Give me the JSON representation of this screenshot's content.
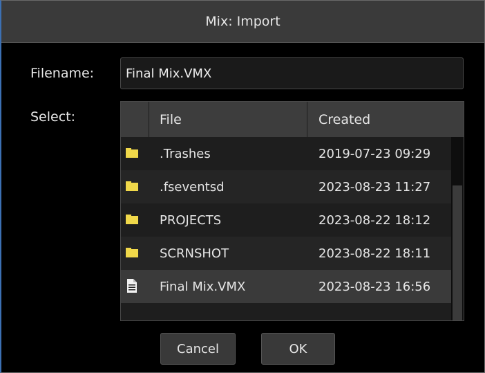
{
  "dialog": {
    "title": "Mix: Import"
  },
  "filename": {
    "label": "Filename:",
    "value": "Final Mix.VMX"
  },
  "select": {
    "label": "Select:"
  },
  "filelist": {
    "columns": [
      "File",
      "Created"
    ],
    "rows": [
      {
        "icon": "folder-icon",
        "name": ".Trashes",
        "created": "2019-07-23 09:29"
      },
      {
        "icon": "folder-icon",
        "name": ".fseventsd",
        "created": "2023-08-23 11:27"
      },
      {
        "icon": "folder-icon",
        "name": "PROJECTS",
        "created": "2023-08-22 18:12"
      },
      {
        "icon": "folder-icon",
        "name": "SCRNSHOT",
        "created": "2023-08-22 18:11"
      },
      {
        "icon": "document-icon",
        "name": "Final Mix.VMX",
        "created": "2023-08-23 16:56",
        "selected": true
      }
    ]
  },
  "buttons": {
    "cancel": "Cancel",
    "ok": "OK"
  },
  "colors": {
    "folder": "#f0d84a",
    "accent_border": "#3c70b3"
  }
}
